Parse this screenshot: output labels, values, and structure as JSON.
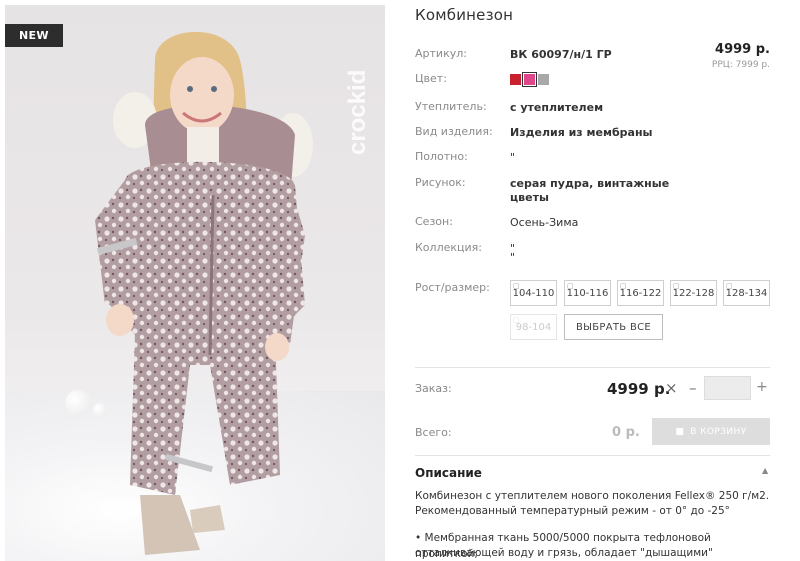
{
  "product": {
    "badge": "NEW",
    "brand": "crockid",
    "title": "Комбинезон"
  },
  "price": {
    "current": "4999 р.",
    "rrp": "РРЦ: 7999 р."
  },
  "attributes": [
    {
      "key": "Артикул:",
      "value": "ВК 60097/н/1 ГР"
    },
    {
      "key": "Цвет:",
      "value": ""
    },
    {
      "key": "Утеплитель:",
      "value": "с утеплителем"
    },
    {
      "key": "Вид изделия:",
      "value": "Изделия из мембраны"
    },
    {
      "key": "Полотно:",
      "value": "\""
    },
    {
      "key": "Рисунок:",
      "value_line1": "серая пудра, винтажные",
      "value_line2": "цветы"
    },
    {
      "key": "Сезон:",
      "value": "Осень-Зима"
    },
    {
      "key": "Коллекция:",
      "value_line1": "\"",
      "value_line2": "\""
    }
  ],
  "colors": [
    {
      "name": "red",
      "hex": "#c8202f",
      "selected": false
    },
    {
      "name": "pink",
      "hex": "#e0468a",
      "selected": true
    },
    {
      "name": "grey",
      "hex": "#a8a8a8",
      "selected": false
    }
  ],
  "size": {
    "label": "Рост/размер:",
    "options": [
      "104-110",
      "110-116",
      "116-122",
      "122-128",
      "128-134"
    ],
    "unavailable": [
      "98-104"
    ],
    "select_all": "ВЫБРАТЬ ВСЕ"
  },
  "order": {
    "label": "Заказ:",
    "price": "4999 р.",
    "times": "×",
    "minus": "–",
    "plus": "+",
    "quantity": ""
  },
  "total": {
    "label": "Всего:",
    "value": "0 р.",
    "cart_button": "В КОРЗИНУ"
  },
  "description": {
    "title": "Описание",
    "para1_line1": "Комбинезон с утеплителем нового поколения Fellex® 250 г/м2.",
    "para1_line2": "Рекомендованный температурный режим - от 0° до -25°",
    "para2_line1": "• Мембранная ткань 5000/5000 покрыта тефлоновой пропиткой,",
    "para2_line2": "отталкивающей воду и грязь, обладает \"дышащими\" свойствами и"
  }
}
